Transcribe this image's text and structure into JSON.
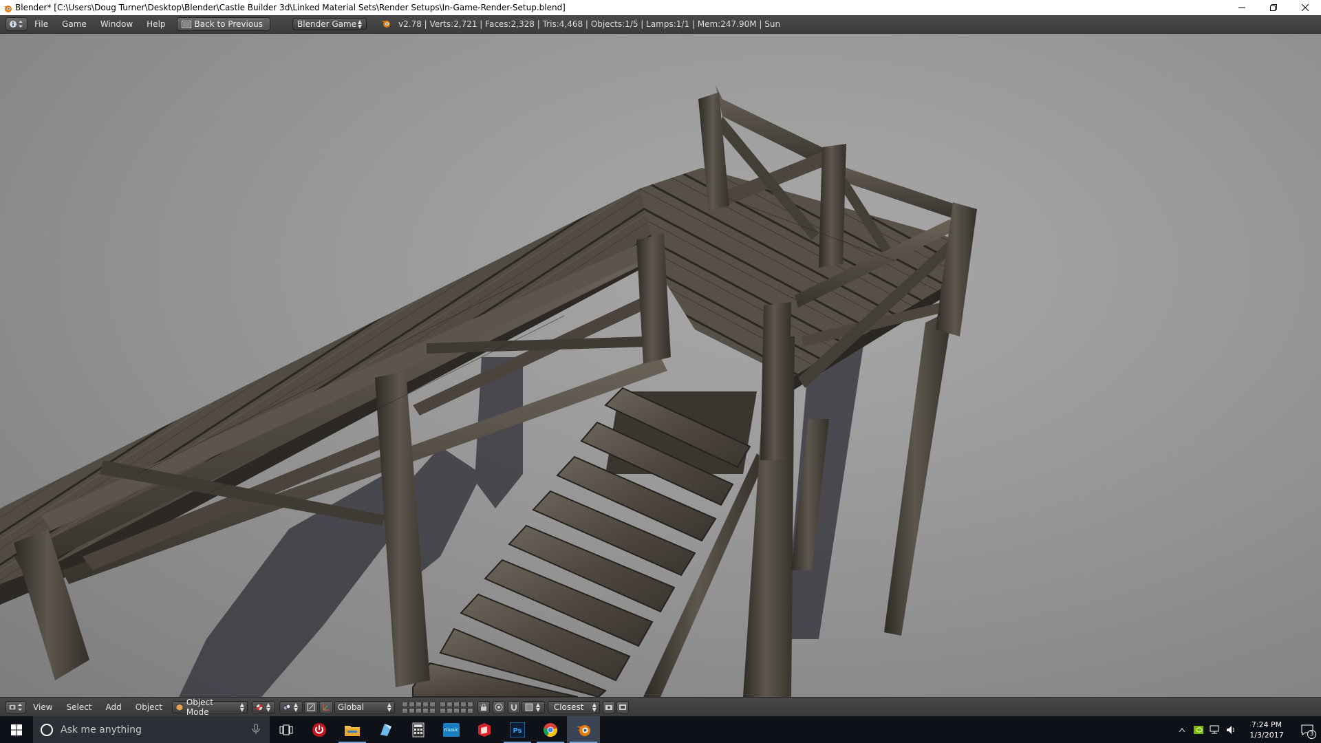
{
  "window": {
    "title": "Blender* [C:\\Users\\Doug Turner\\Desktop\\Blender\\Castle Builder 3d\\Linked Material Sets\\Render Setups\\In-Game-Render-Setup.blend]",
    "controls": [
      "minimize",
      "restore",
      "close"
    ]
  },
  "info_header": {
    "menus": [
      "File",
      "Game",
      "Window",
      "Help"
    ],
    "back_label": "Back to Previous",
    "engine": "Blender Game",
    "stats": "v2.78 | Verts:2,721 | Faces:2,328 | Tris:4,468 | Objects:1/5 | Lamps:1/1 | Mem:247.90M | Sun"
  },
  "view3d_header": {
    "menus": [
      "View",
      "Select",
      "Add",
      "Object"
    ],
    "mode": "Object Mode",
    "orientation": "Global",
    "snap_target": "Closest"
  },
  "taskbar": {
    "search_placeholder": "Ask me anything",
    "apps": [
      "task-view",
      "power",
      "file-explorer",
      "app-blue",
      "calculator",
      "amazon-music",
      "app-red",
      "photoshop",
      "chrome",
      "blender"
    ],
    "time": "7:24 PM",
    "date": "1/3/2017",
    "notification_count": "3"
  },
  "colors": {
    "viewport_bg": "#979797",
    "wood_dark": "#3a3631",
    "wood_mid": "#5a544b",
    "taskbar": "#0e1218"
  }
}
